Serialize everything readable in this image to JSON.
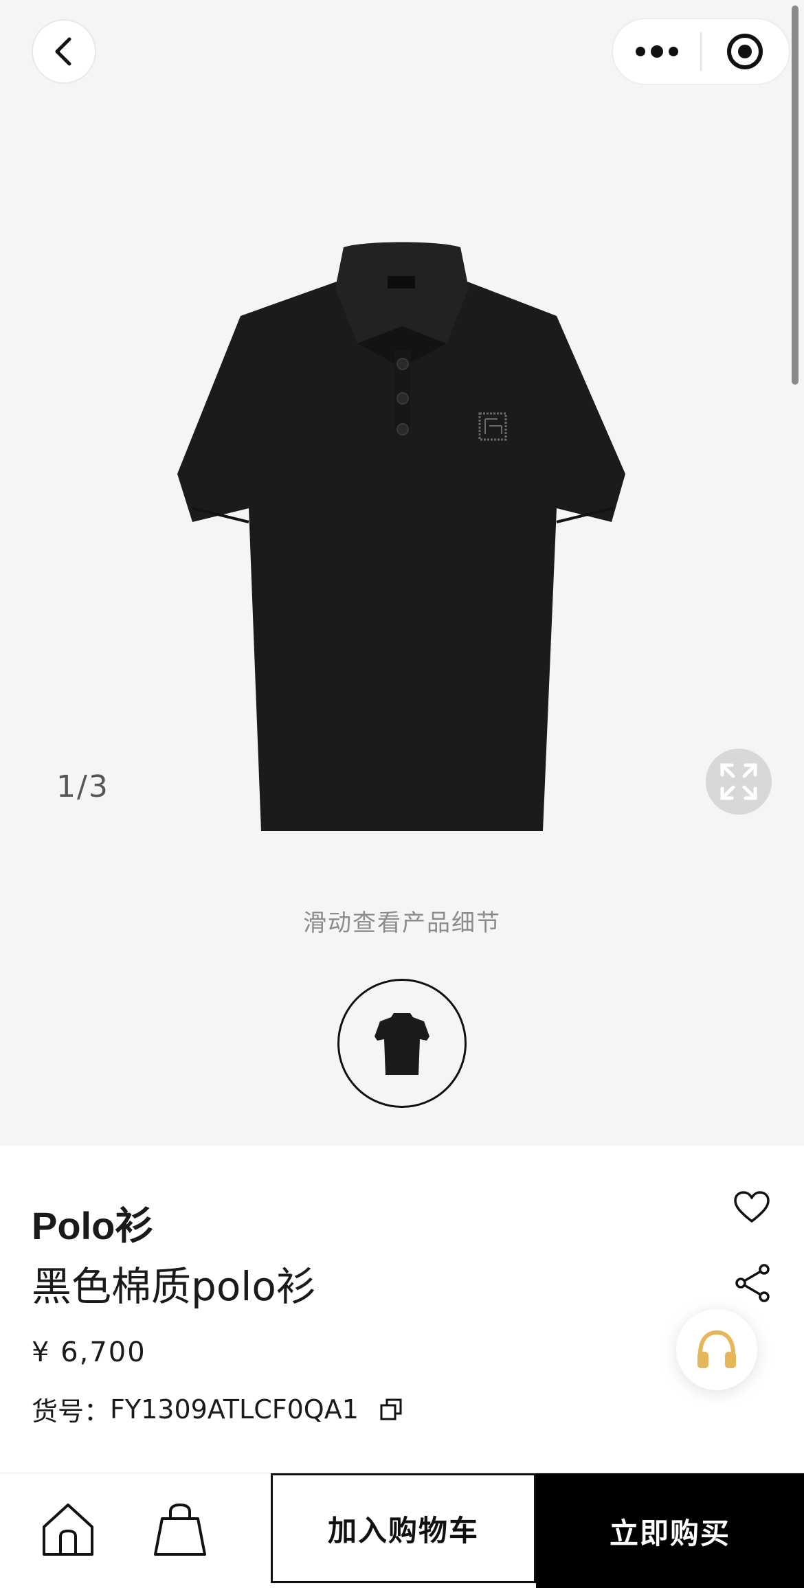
{
  "header": {
    "back_icon": "chevron-left-icon",
    "more_icon": "more-dots-icon",
    "close_icon": "target-circle-icon"
  },
  "gallery": {
    "counter": "1/3",
    "swipe_hint": "滑动查看产品细节",
    "expand_icon": "expand-arrows-icon",
    "product_color": "#1c1a1b"
  },
  "product": {
    "title": "Polo衫",
    "subtitle": "黑色棉质polo衫",
    "price": "¥ 6,700",
    "sku_label": "货号：",
    "sku_value": "FY1309ATLCF0QA1"
  },
  "actions": {
    "favorite_icon": "heart-icon",
    "share_icon": "share-icon",
    "service_icon": "headphones-icon",
    "service_color": "#e8b65a"
  },
  "bottom_bar": {
    "home_icon": "home-icon",
    "bag_icon": "shopping-bag-icon",
    "add_to_cart": "加入购物车",
    "buy_now": "立即购买"
  }
}
